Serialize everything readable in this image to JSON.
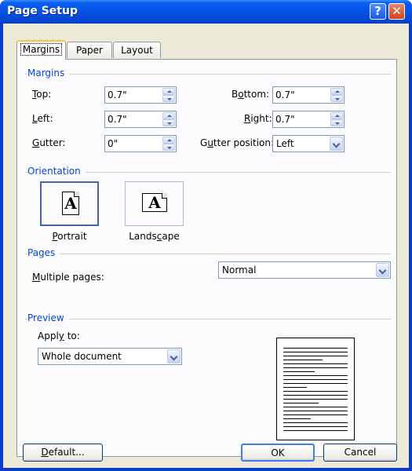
{
  "window": {
    "title": "Page Setup",
    "help_glyph": "?",
    "close_glyph": "✕"
  },
  "tabs": [
    {
      "label": "Margins",
      "active": true
    },
    {
      "label": "Paper",
      "active": false
    },
    {
      "label": "Layout",
      "active": false
    }
  ],
  "margins": {
    "group_label": "Margins",
    "top": {
      "label_key": "T",
      "label_rest": "op:",
      "value": "0.7\""
    },
    "bottom": {
      "label_pre": "B",
      "label_key": "o",
      "label_rest": "ttom:",
      "value": "0.7\""
    },
    "left": {
      "label_key": "L",
      "label_rest": "eft:",
      "value": "0.7\""
    },
    "right": {
      "label_key": "R",
      "label_rest": "ight:",
      "value": "0.7\""
    },
    "gutter": {
      "label_key": "G",
      "label_rest": "utter:",
      "value": "0\""
    },
    "gutter_position": {
      "label_pre": "G",
      "label_key": "u",
      "label_rest": "tter position:",
      "value": "Left"
    }
  },
  "orientation": {
    "group_label": "Orientation",
    "portrait": {
      "label_key": "P",
      "label_rest": "ortrait",
      "glyph": "A",
      "selected": true
    },
    "landscape": {
      "label_pre": "Lands",
      "label_key": "c",
      "label_rest": "ape",
      "glyph": "A",
      "selected": false
    }
  },
  "pages": {
    "group_label": "Pages",
    "multiple_pages": {
      "label_key": "M",
      "label_rest": "ultiple pages:",
      "value": "Normal"
    }
  },
  "preview": {
    "group_label": "Preview",
    "apply_to": {
      "label_pre": "Appl",
      "label_key": "y",
      "label_rest": " to:",
      "value": "Whole document"
    }
  },
  "buttons": {
    "default": {
      "label_key": "D",
      "label_rest": "efault..."
    },
    "ok": "OK",
    "cancel": "Cancel"
  }
}
